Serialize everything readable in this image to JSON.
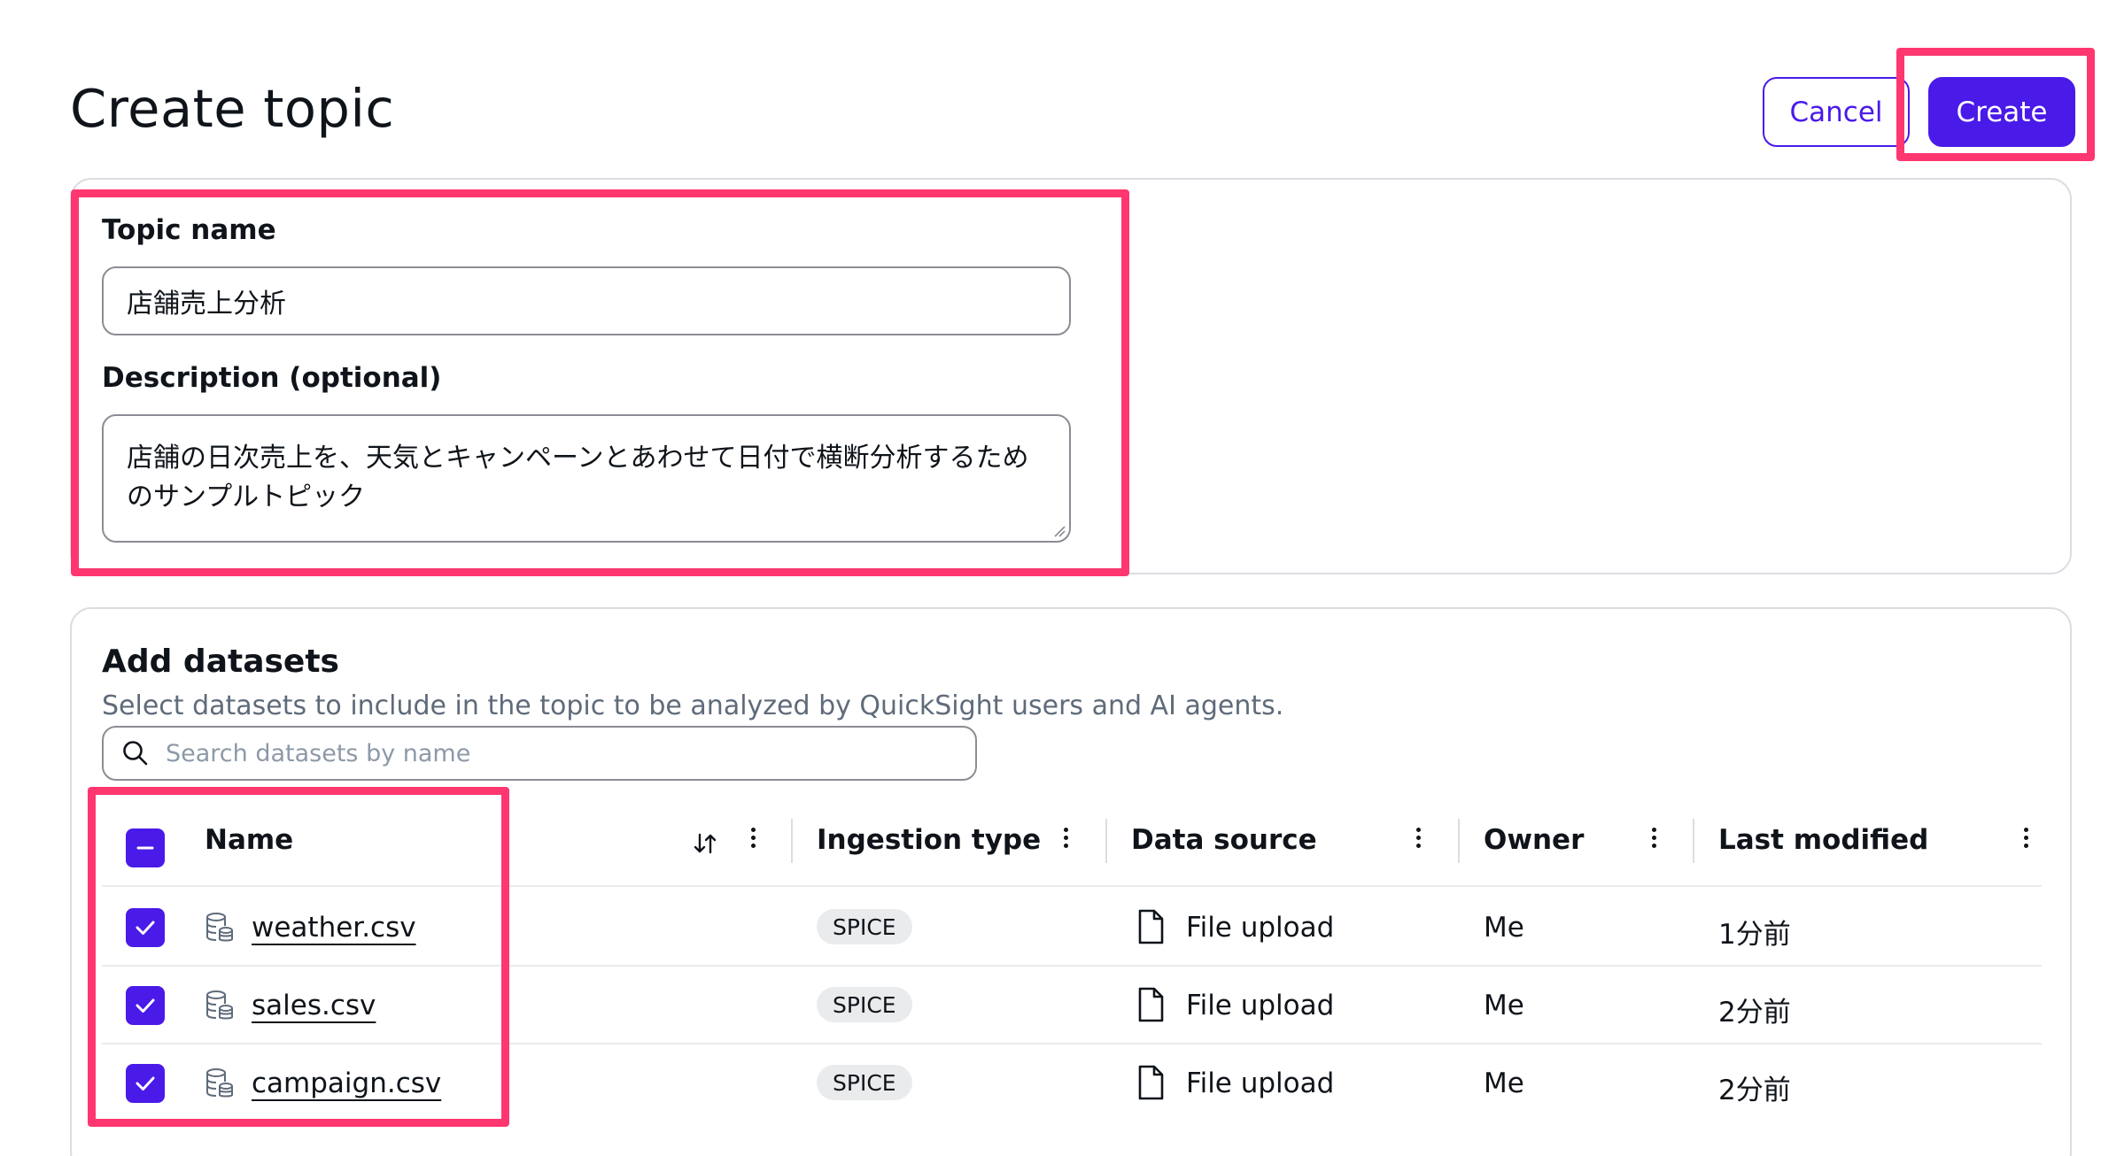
{
  "page": {
    "title": "Create topic"
  },
  "actions": {
    "cancel_label": "Cancel",
    "create_label": "Create"
  },
  "topic": {
    "name_label": "Topic name",
    "name_value": "店舗売上分析",
    "description_label": "Description (optional)",
    "description_value": "店舗の日次売上を、天気とキャンペーンとあわせて日付で横断分析するためのサンプルトピック"
  },
  "datasets": {
    "title": "Add datasets",
    "subtitle": "Select datasets to include in the topic to be analyzed by QuickSight users and AI agents.",
    "search_placeholder": "Search datasets by name",
    "columns": [
      "Name",
      "Ingestion type",
      "Data source",
      "Owner",
      "Last modified"
    ],
    "rows": [
      {
        "name": "weather.csv",
        "ingestion": "SPICE",
        "source": "File upload",
        "owner": "Me",
        "modified": "1分前",
        "selected": true
      },
      {
        "name": "sales.csv",
        "ingestion": "SPICE",
        "source": "File upload",
        "owner": "Me",
        "modified": "2分前",
        "selected": true
      },
      {
        "name": "campaign.csv",
        "ingestion": "SPICE",
        "source": "File upload",
        "owner": "Me",
        "modified": "2分前",
        "selected": true
      }
    ]
  },
  "colors": {
    "accent": "#4a1ae8",
    "highlight": "#ff3670",
    "badge_bg": "#e9ebed"
  },
  "icons": [
    "search-icon",
    "sort-icon",
    "more-icon",
    "dataset-icon",
    "file-icon",
    "checkmark-icon",
    "minus-icon"
  ]
}
